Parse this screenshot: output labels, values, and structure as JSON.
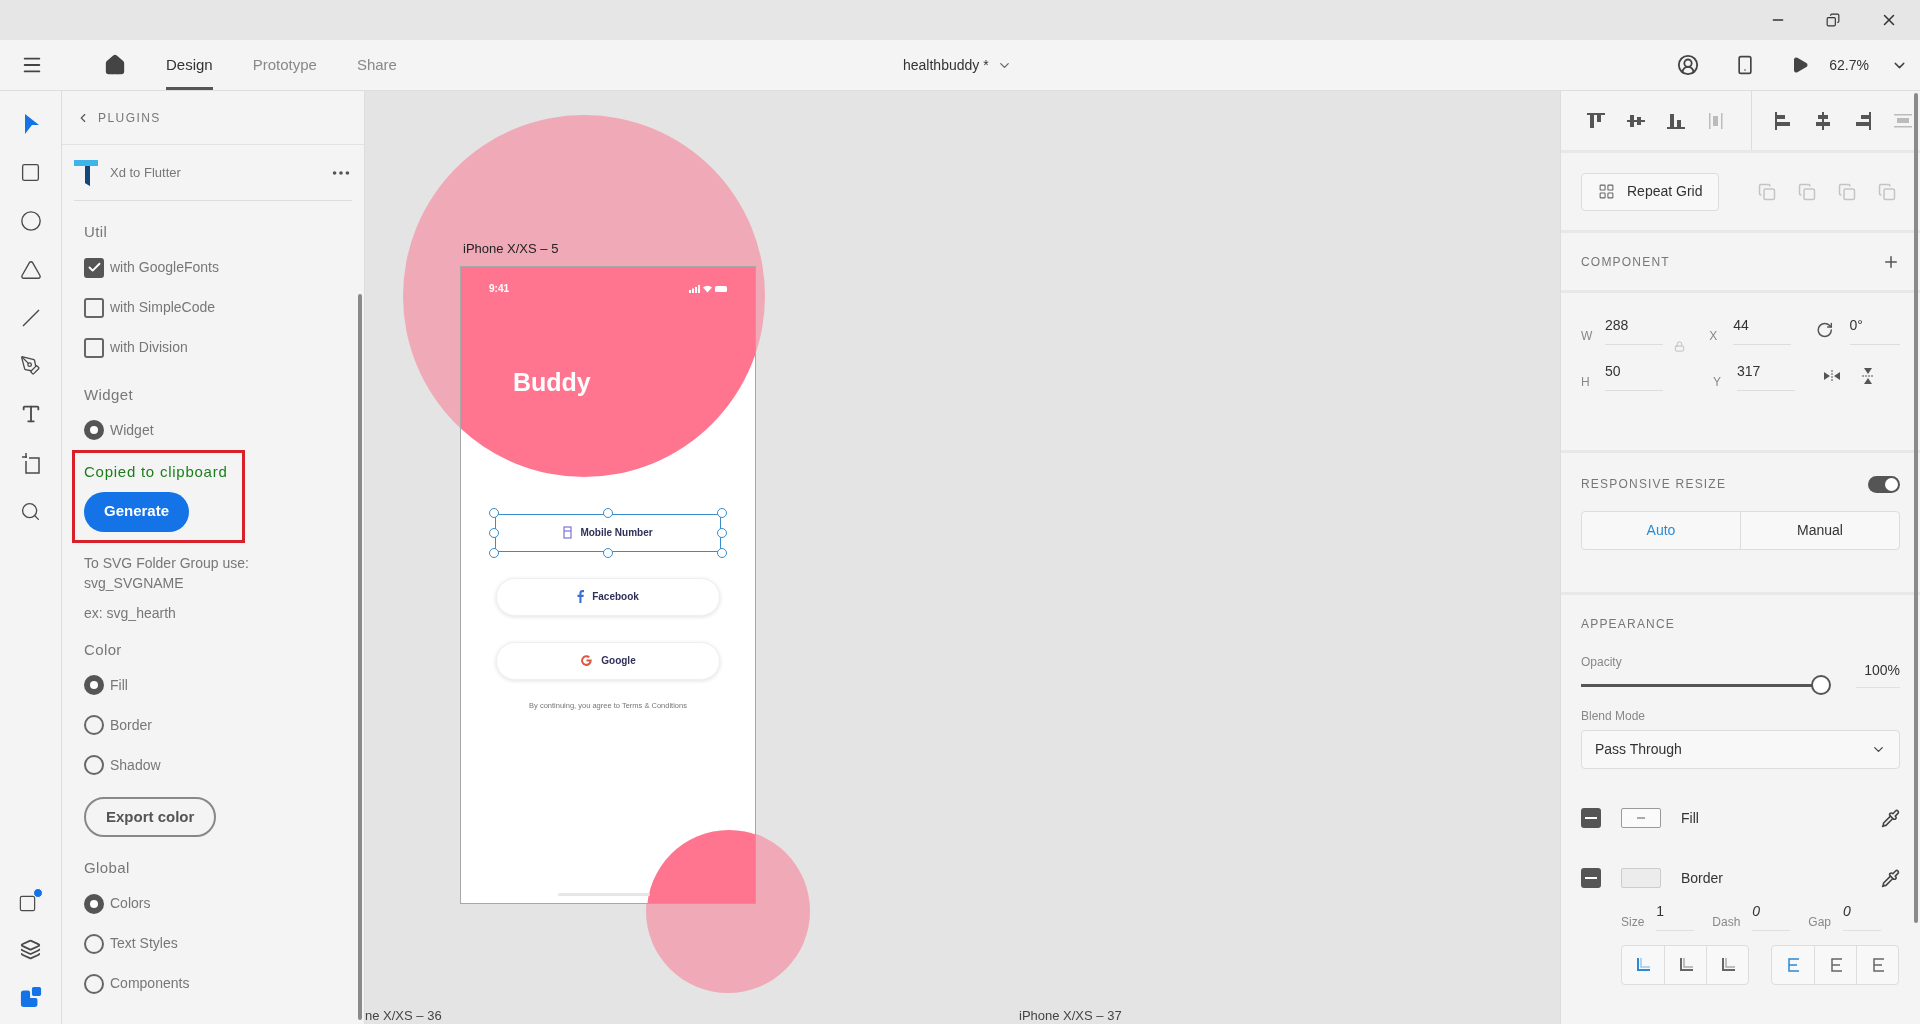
{
  "toolbar": {
    "tabs": [
      {
        "label": "Design",
        "selected": true
      },
      {
        "label": "Prototype",
        "selected": false
      },
      {
        "label": "Share",
        "selected": false
      }
    ],
    "document_title": "healthbuddy *",
    "zoom": "62.7%"
  },
  "plugin_panel": {
    "back_label": "PLUGINS",
    "plugin_name": "Xd to Flutter",
    "blocks": [
      {
        "kind": "heading",
        "label": "Util"
      },
      {
        "kind": "checkbox",
        "label": "with GoogleFonts",
        "checked": true
      },
      {
        "kind": "checkbox",
        "label": "with SimpleCode",
        "checked": false
      },
      {
        "kind": "checkbox",
        "label": "with Division",
        "checked": false
      },
      {
        "kind": "heading",
        "label": "Widget"
      },
      {
        "kind": "radio",
        "label": "Widget",
        "selected": true
      },
      {
        "kind": "status",
        "label": "Copied to clipboard"
      },
      {
        "kind": "primary_button",
        "label": "Generate"
      },
      {
        "kind": "note",
        "label": "To SVG Folder Group use:\nsvg_SVGNAME"
      },
      {
        "kind": "note",
        "label": "ex: svg_hearth"
      },
      {
        "kind": "heading",
        "label": "Color"
      },
      {
        "kind": "radio",
        "label": "Fill",
        "selected": true
      },
      {
        "kind": "radio",
        "label": "Border",
        "selected": false
      },
      {
        "kind": "radio",
        "label": "Shadow",
        "selected": false
      },
      {
        "kind": "secondary_button",
        "label": "Export color"
      },
      {
        "kind": "heading",
        "label": "Global"
      },
      {
        "kind": "radio",
        "label": "Colors",
        "selected": true
      },
      {
        "kind": "radio",
        "label": "Text Styles",
        "selected": false
      },
      {
        "kind": "radio",
        "label": "Components",
        "selected": false
      }
    ]
  },
  "canvas": {
    "artboard_label": "iPhone X/XS – 5",
    "artboard": {
      "time": "9:41",
      "title": "Buddy",
      "buttons": [
        {
          "kind": "phone",
          "label": "Mobile Number",
          "selected": true
        },
        {
          "kind": "facebook",
          "label": "Facebook",
          "selected": false
        },
        {
          "kind": "google",
          "label": "Google",
          "selected": false
        }
      ],
      "terms": "By continuing, you agree to Terms & Conditions"
    },
    "other_labels": [
      "ne X/XS – 36",
      "iPhone X/XS – 37"
    ]
  },
  "properties": {
    "repeat_grid": "Repeat Grid",
    "component_heading": "COMPONENT",
    "transform": [
      {
        "label": "W",
        "value": "288"
      },
      {
        "label": "X",
        "value": "44"
      },
      {
        "label": "H",
        "value": "50"
      },
      {
        "label": "Y",
        "value": "317"
      }
    ],
    "rotation": "0°",
    "responsive": {
      "heading": "RESPONSIVE RESIZE",
      "on": true,
      "modes": [
        {
          "label": "Auto",
          "selected": true
        },
        {
          "label": "Manual",
          "selected": false
        }
      ]
    },
    "appearance": {
      "heading": "APPEARANCE",
      "opacity_label": "Opacity",
      "opacity": {
        "level": 1
      },
      "opacity_value": "100%",
      "blend_label": "Blend Mode",
      "blend_value": "Pass Through",
      "layers": [
        {
          "kind": "fill",
          "label": "Fill",
          "enabled": true
        },
        {
          "kind": "border",
          "label": "Border",
          "enabled": true
        }
      ],
      "border_settings": [
        {
          "label": "Size",
          "value": "1"
        },
        {
          "label": "Dash",
          "value": "0"
        },
        {
          "label": "Gap",
          "value": "0"
        }
      ],
      "stroke_position": [
        {
          "selected": true
        },
        {
          "selected": false
        },
        {
          "selected": false
        }
      ],
      "stroke_join": [
        {
          "selected": true
        },
        {
          "selected": false
        },
        {
          "selected": false
        }
      ]
    }
  }
}
